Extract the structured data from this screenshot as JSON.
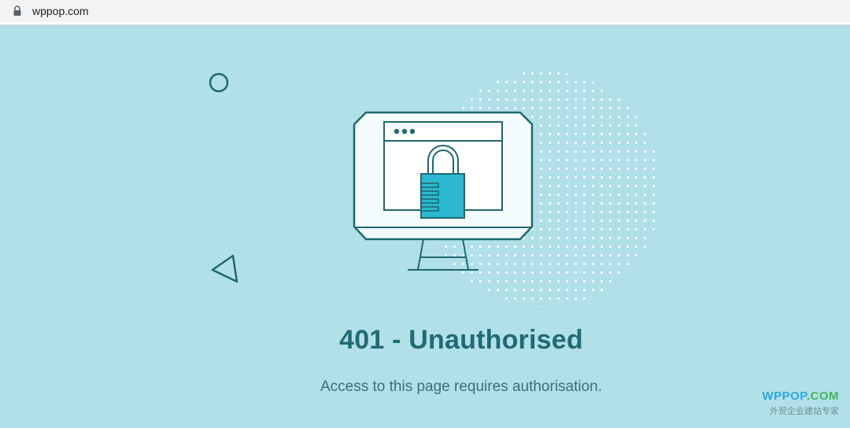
{
  "browser": {
    "url": "wppop.com"
  },
  "main": {
    "title": "401 - Unauthorised",
    "message": "Access to this page requires authorisation."
  },
  "watermark": {
    "brand_main": "WPPOP",
    "brand_suffix": ".COM",
    "tagline": "外贸企业建站专家"
  },
  "colors": {
    "background": "#b1e0e8",
    "title": "#206a74",
    "outline": "#1f6870",
    "lock": "#2bb8d0",
    "screen": "#f3fbfc",
    "watermark_blue": "#2ea7e0",
    "watermark_green": "#43b65d"
  },
  "icons": {
    "address_lock": "lock-icon",
    "illustration": "computer-padlock-illustration",
    "decor_circle": "circle-icon",
    "decor_triangle": "triangle-icon"
  }
}
